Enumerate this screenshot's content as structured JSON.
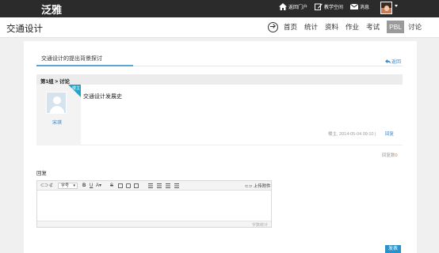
{
  "topbar": {
    "logo": "泛雅",
    "links": [
      {
        "label": "返回门户",
        "icon": "home-icon"
      },
      {
        "label": "教学空间",
        "icon": "edit-icon"
      },
      {
        "label": "消息",
        "icon": "mail-icon"
      }
    ]
  },
  "course": {
    "title": "交通设计",
    "nav": [
      {
        "label": "首页"
      },
      {
        "label": "统计"
      },
      {
        "label": "资料"
      },
      {
        "label": "作业"
      },
      {
        "label": "考试"
      },
      {
        "label": "PBL",
        "active": true
      },
      {
        "label": "讨论"
      }
    ]
  },
  "topic": {
    "title": "交通设计的提出背景探讨",
    "back_label": "返回"
  },
  "post": {
    "group_path": "第1组 > 讨论",
    "badge": "楼主",
    "author": "宋琪",
    "content": "交通设计发展史",
    "meta": "楼主, 2014-05-04 09:10 |",
    "reply_link": "回复"
  },
  "reply_count": {
    "label": "回复数",
    "count": "0"
  },
  "reply_form": {
    "label": "回复",
    "font_select": "字号",
    "upload_label": "上传附件",
    "wordcount_label": "字数统计",
    "submit_label": "发表"
  },
  "colors": {
    "accent": "#2a92c9",
    "link": "#3d86c6",
    "topbar": "#2b2b2b"
  }
}
